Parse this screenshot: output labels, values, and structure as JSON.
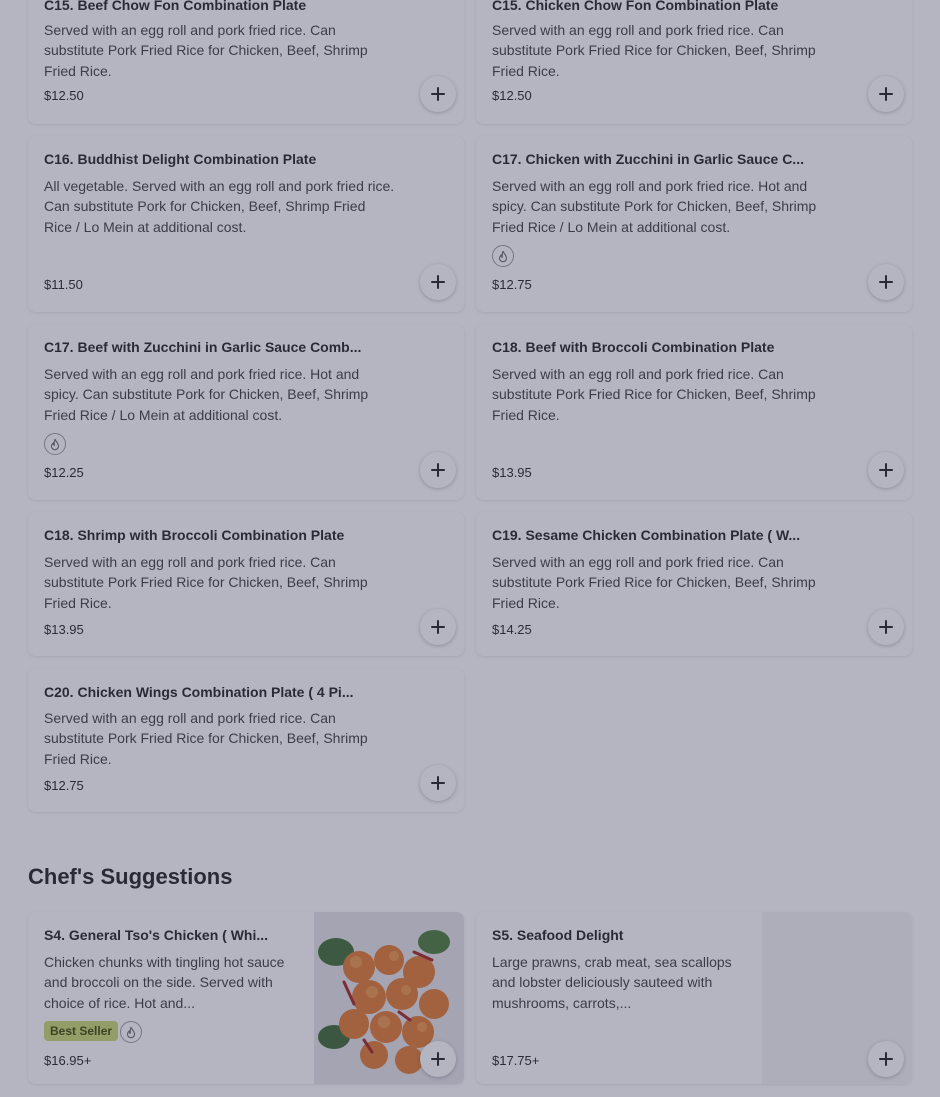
{
  "menu_items": [
    {
      "title": "C15. Beef Chow Fon Combination Plate",
      "desc": "Served with an egg roll and pork fried rice. Can substitute Pork Fried Rice for Chicken, Beef, Shrimp Fried Rice.",
      "price": "$12.50"
    },
    {
      "title": "C15. Chicken Chow Fon Combination Plate",
      "desc": "Served with an egg roll and pork fried rice. Can substitute Pork Fried Rice for Chicken, Beef, Shrimp Fried Rice.",
      "price": "$12.50"
    },
    {
      "title": "C16. Buddhist Delight Combination Plate",
      "desc": "All vegetable. Served with an egg roll and pork fried rice. Can substitute Pork for Chicken, Beef, Shrimp Fried Rice / Lo Mein at additional cost.",
      "price": "$11.50"
    },
    {
      "title": "C17. Chicken with Zucchini in Garlic Sauce C...",
      "desc": "Served with an egg roll and pork fried rice. Hot and spicy. Can substitute Pork for Chicken, Beef, Shrimp Fried Rice / Lo Mein at additional cost.",
      "price": "$12.75"
    },
    {
      "title": "C17. Beef with Zucchini in Garlic Sauce Comb...",
      "desc": "Served with an egg roll and pork fried rice. Hot and spicy. Can substitute Pork for Chicken, Beef, Shrimp Fried Rice / Lo Mein at additional cost.",
      "price": "$12.25"
    },
    {
      "title": "C18. Beef with Broccoli Combination Plate",
      "desc": "Served with an egg roll and pork fried rice. Can substitute Pork Fried Rice for Chicken, Beef, Shrimp Fried Rice.",
      "price": "$13.95"
    },
    {
      "title": "C18. Shrimp with Broccoli Combination Plate",
      "desc": "Served with an egg roll and pork fried rice. Can substitute Pork Fried Rice for Chicken, Beef, Shrimp Fried Rice.",
      "price": "$13.95"
    },
    {
      "title": "C19. Sesame Chicken Combination Plate ( W...",
      "desc": "Served with an egg roll and pork fried rice. Can substitute Pork Fried Rice for Chicken, Beef, Shrimp Fried Rice.",
      "price": "$14.25"
    },
    {
      "title": "C20. Chicken Wings Combination Plate ( 4 Pi...",
      "desc": "Served with an egg roll and pork fried rice. Can substitute Pork Fried Rice for Chicken, Beef, Shrimp Fried Rice.",
      "price": "$12.75"
    }
  ],
  "section": {
    "title": "Chef's Suggestions"
  },
  "suggestions": [
    {
      "title": "S4. General Tso's Chicken ( Whi...",
      "desc": "Chicken chunks with tingling hot sauce and broccoli on the side. Served with choice of rice. Hot and...",
      "badge": "Best Seller",
      "price": "$16.95+"
    },
    {
      "title": "S5. Seafood Delight",
      "desc": "Large prawns, crab meat, sea scallops and lobster deliciously sauteed with mushrooms, carrots,...",
      "price": "$17.75+"
    }
  ],
  "icons": {
    "add": "plus-icon",
    "spicy": "flame-icon"
  },
  "colors": {
    "overlay": "#3c3c5f",
    "badge_bg": "#c7d96d"
  }
}
